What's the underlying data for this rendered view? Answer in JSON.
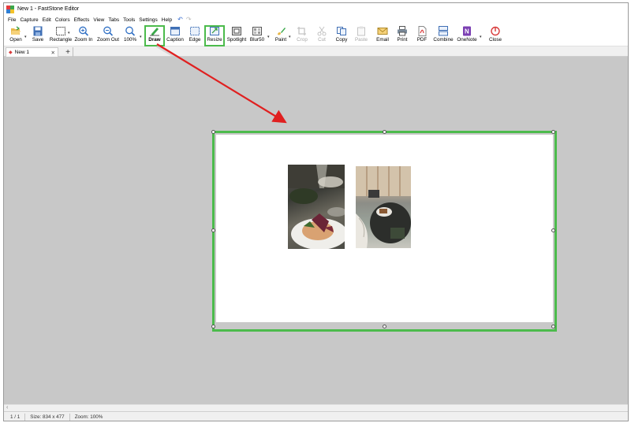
{
  "window": {
    "title": "New 1 - FastStone Editor"
  },
  "menu": [
    "File",
    "Capture",
    "Edit",
    "Colors",
    "Effects",
    "View",
    "Tabs",
    "Tools",
    "Settings",
    "Help"
  ],
  "toolbar": {
    "open": "Open",
    "save": "Save",
    "rectangle": "Rectangle",
    "zoom_in": "Zoom In",
    "zoom_out": "Zoom Out",
    "zoom_level": "100%",
    "draw": "Draw",
    "caption": "Caption",
    "edge": "Edge",
    "resize": "Resize",
    "spotlight": "Spotlight",
    "blur": "Blur50",
    "paint": "Paint",
    "crop": "Crop",
    "cut": "Cut",
    "copy": "Copy",
    "paste": "Paste",
    "email": "Email",
    "print": "Print",
    "pdf": "PDF",
    "combine": "Combine",
    "onenote": "OneNote",
    "close": "Close"
  },
  "tabs": {
    "active": "New 1",
    "new_tab": "+"
  },
  "status": {
    "page": "1 / 1",
    "size": "Size: 834 x 477",
    "zoom": "Zoom: 100%"
  },
  "colors": {
    "highlight": "#4cbb4c",
    "arrow": "#e02020",
    "workspace": "#c8c8c8"
  }
}
